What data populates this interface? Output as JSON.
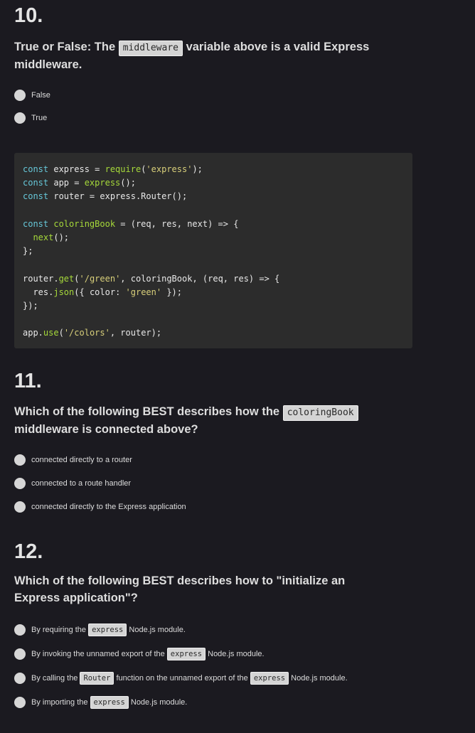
{
  "colors": {
    "background": "#1b1a20",
    "code_background": "#2c2c2c",
    "keyword": "#66c7d8",
    "function": "#a6d93a",
    "string": "#d8cf7a",
    "chip_background": "#d4d4d4",
    "radio": "#d6d6d6"
  },
  "questions": [
    {
      "number": "10.",
      "prompt_before": "True or False: The ",
      "prompt_code": "middleware",
      "prompt_after": " variable above is a valid Express middleware.",
      "options": [
        {
          "label": "False",
          "selected": false
        },
        {
          "label": "True",
          "selected": false
        }
      ]
    },
    {
      "number": "11.",
      "prompt_before": "Which of the following BEST describes how the ",
      "prompt_code": "coloringBook",
      "prompt_after": " middleware is connected above?",
      "options": [
        {
          "label": "connected directly to a router",
          "selected": false
        },
        {
          "label": "connected to a route handler",
          "selected": false
        },
        {
          "label": "connected directly to the Express application",
          "selected": false
        }
      ]
    },
    {
      "number": "12.",
      "prompt": "Which of the following BEST describes how to \"initialize an Express application\"?",
      "options": [
        {
          "parts": [
            "By requiring the ",
            "express",
            " Node.js module."
          ],
          "selected": false
        },
        {
          "parts": [
            "By invoking the unnamed export of the ",
            "express",
            " Node.js module."
          ],
          "selected": false
        },
        {
          "parts": [
            "By calling the ",
            "Router",
            " function on the unnamed export of the ",
            "express",
            " Node.js module."
          ],
          "selected": false
        },
        {
          "parts": [
            "By importing the ",
            "express",
            " Node.js module."
          ],
          "selected": false
        }
      ]
    }
  ],
  "code": {
    "language": "javascript",
    "lines": [
      [
        [
          "kw",
          "const"
        ],
        [
          "plain",
          " express = "
        ],
        [
          "fn",
          "require"
        ],
        [
          "plain",
          "("
        ],
        [
          "str",
          "'express'"
        ],
        [
          "plain",
          ");"
        ]
      ],
      [
        [
          "kw",
          "const"
        ],
        [
          "plain",
          " app = "
        ],
        [
          "fn",
          "express"
        ],
        [
          "plain",
          "();"
        ]
      ],
      [
        [
          "kw",
          "const"
        ],
        [
          "plain",
          " router = express.Router();"
        ]
      ],
      [],
      [
        [
          "kw",
          "const"
        ],
        [
          "plain",
          " "
        ],
        [
          "fn",
          "coloringBook"
        ],
        [
          "plain",
          " = (req, res, next) => {"
        ]
      ],
      [
        [
          "plain",
          "  "
        ],
        [
          "fn",
          "next"
        ],
        [
          "plain",
          "();"
        ]
      ],
      [
        [
          "plain",
          "};"
        ]
      ],
      [],
      [
        [
          "plain",
          "router."
        ],
        [
          "fn",
          "get"
        ],
        [
          "plain",
          "("
        ],
        [
          "str",
          "'/green'"
        ],
        [
          "plain",
          ", coloringBook, (req, res) => {"
        ]
      ],
      [
        [
          "plain",
          "  res."
        ],
        [
          "fn",
          "json"
        ],
        [
          "plain",
          "({ color: "
        ],
        [
          "str",
          "'green'"
        ],
        [
          "plain",
          " });"
        ]
      ],
      [
        [
          "plain",
          "});"
        ]
      ],
      [],
      [
        [
          "plain",
          "app."
        ],
        [
          "fn",
          "use"
        ],
        [
          "plain",
          "("
        ],
        [
          "str",
          "'/colors'"
        ],
        [
          "plain",
          ", router);"
        ]
      ]
    ]
  }
}
